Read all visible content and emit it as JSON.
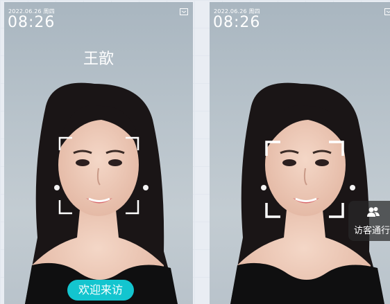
{
  "left_screen": {
    "date": "2022.06.26 周四",
    "time": "08:26",
    "recognized_name": "王歆",
    "welcome_message": "欢迎来访",
    "top_right_icon": "screen-icon"
  },
  "right_screen": {
    "date": "2022.06.26 周四",
    "time": "08:26",
    "visitor_button_label": "访客通行",
    "visitor_icon": "visitor-icon",
    "top_right_icon": "screen-icon"
  },
  "colors": {
    "accent": "#13c5cf",
    "frame": "#ffffff",
    "visitor_bg": "#282828"
  }
}
